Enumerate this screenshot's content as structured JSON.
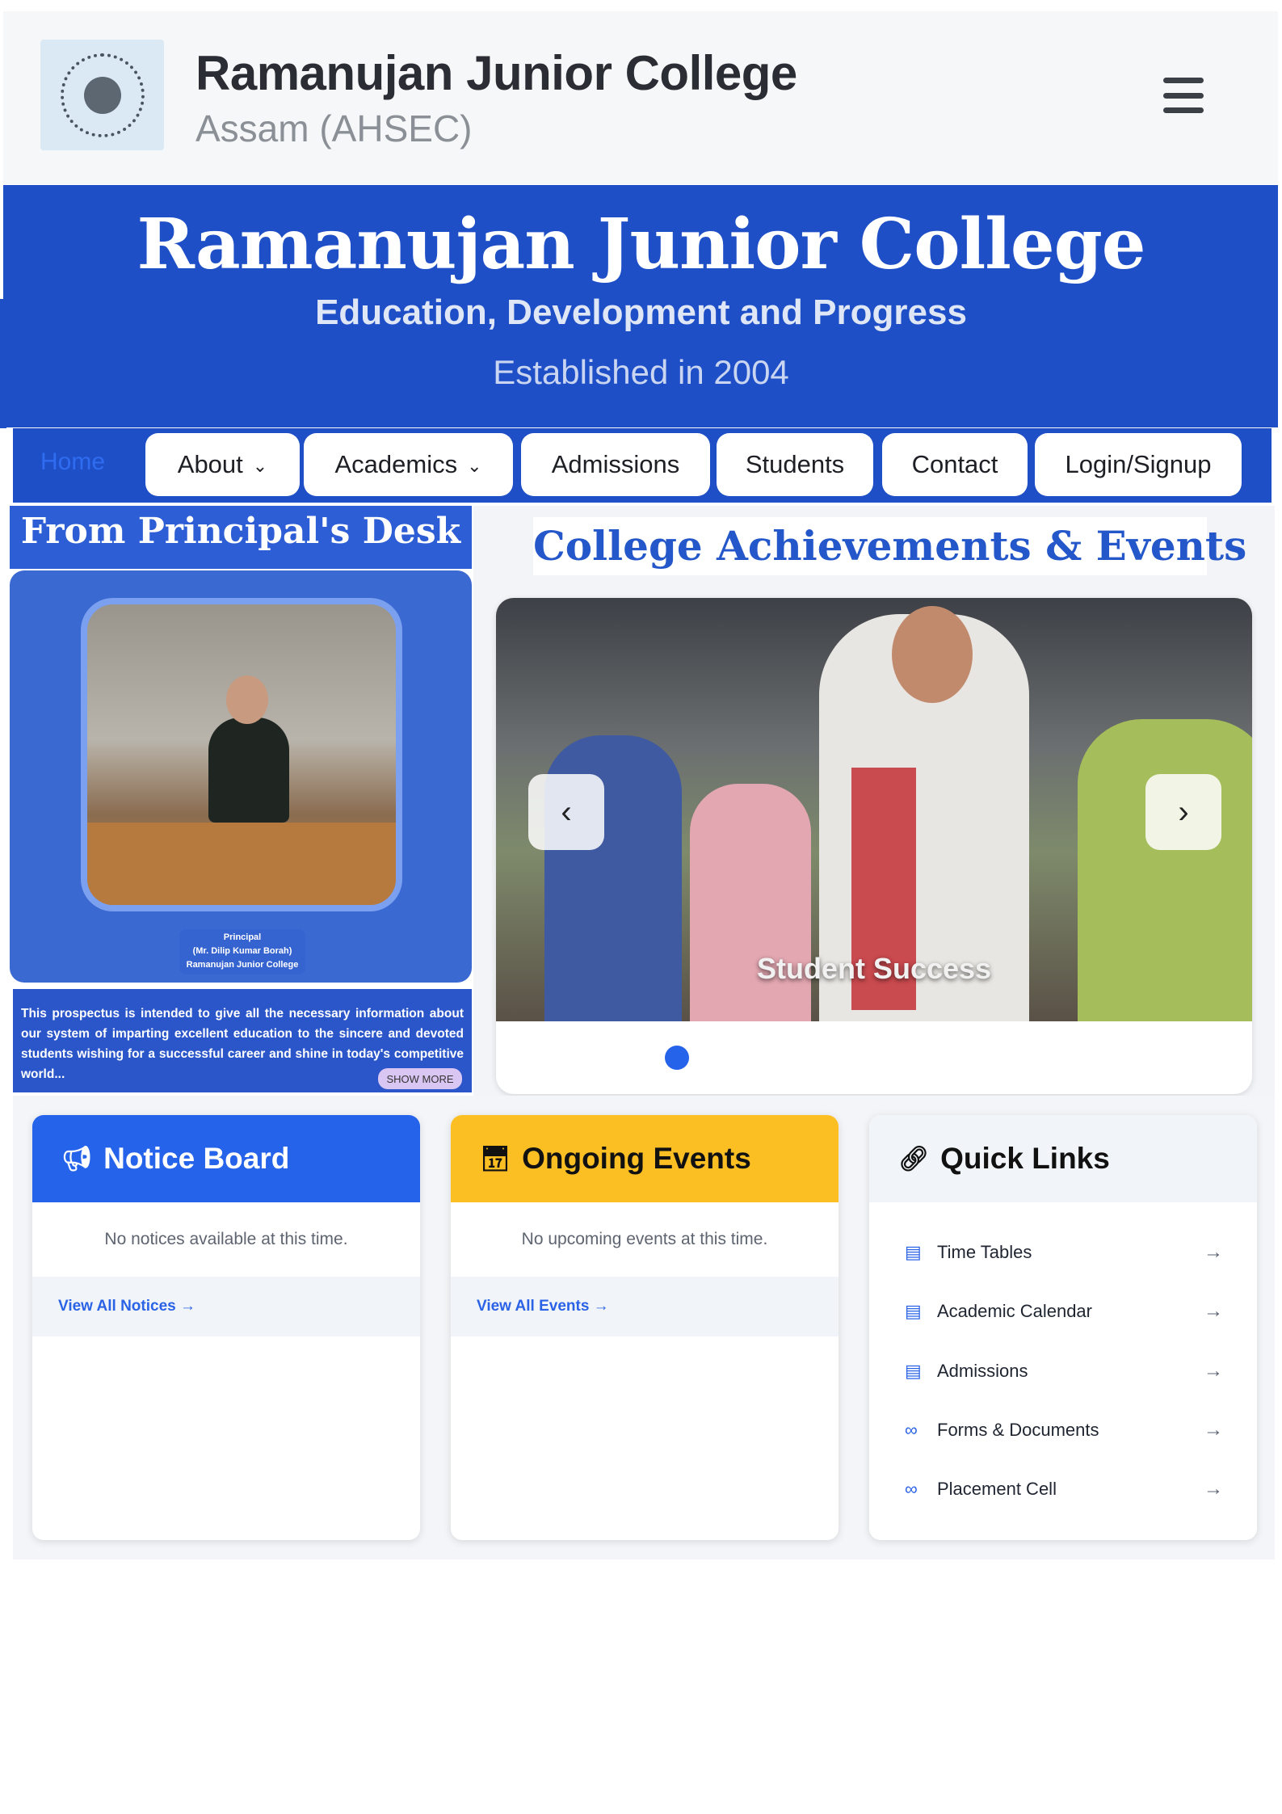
{
  "header": {
    "title": "Ramanujan Junior College",
    "subtitle": "Assam (AHSEC)",
    "logo_icon": "college-seal-icon",
    "menu_icon": "hamburger-menu-icon"
  },
  "banner": {
    "title": "Ramanujan Junior College",
    "tagline": "Education, Development and Progress",
    "established": "Established in 2004"
  },
  "nav": {
    "home": "Home",
    "items": [
      {
        "label": "About",
        "dropdown": true
      },
      {
        "label": "Academics",
        "dropdown": true
      },
      {
        "label": "Admissions",
        "dropdown": false
      },
      {
        "label": "Students",
        "dropdown": false
      },
      {
        "label": "Contact",
        "dropdown": false
      },
      {
        "label": "Login/Signup",
        "dropdown": false
      }
    ],
    "chevron": "⌄"
  },
  "principal": {
    "heading": "From Principal's Desk",
    "role": "Principal",
    "name": "(Mr. Dilip Kumar Borah)",
    "college": "Ramanujan Junior College",
    "message": "This prospectus is intended to give all the necessary information about our system of imparting excellent education to the sincere and devoted students wishing for a successful career and shine in today's competitive world...",
    "show_more": "SHOW MORE"
  },
  "achievements": {
    "heading": "College Achievements & Events",
    "slide_caption": "Student Success",
    "prev": "‹",
    "next": "›"
  },
  "notice_board": {
    "title": "Notice Board",
    "icon": "megaphone-icon",
    "empty": "No notices available at this time.",
    "link": "View All Notices →"
  },
  "events": {
    "title": "Ongoing Events",
    "icon": "calendar-icon",
    "empty": "No upcoming events at this time.",
    "link": "View All Events →"
  },
  "quick_links": {
    "title": "Quick Links",
    "icon": "link-icon",
    "items": [
      {
        "label": "Time Tables",
        "icon": "calendar-icon"
      },
      {
        "label": "Academic Calendar",
        "icon": "calendar-icon"
      },
      {
        "label": "Admissions",
        "icon": "calendar-icon"
      },
      {
        "label": "Forms & Documents",
        "icon": "link-icon"
      },
      {
        "label": "Placement Cell",
        "icon": "link-icon"
      }
    ],
    "arrow": "→"
  },
  "colors": {
    "brand_blue": "#1e4fc7",
    "notice_blue": "#2563eb",
    "events_yellow": "#fbbf24",
    "link_blue": "#2b63e6"
  }
}
